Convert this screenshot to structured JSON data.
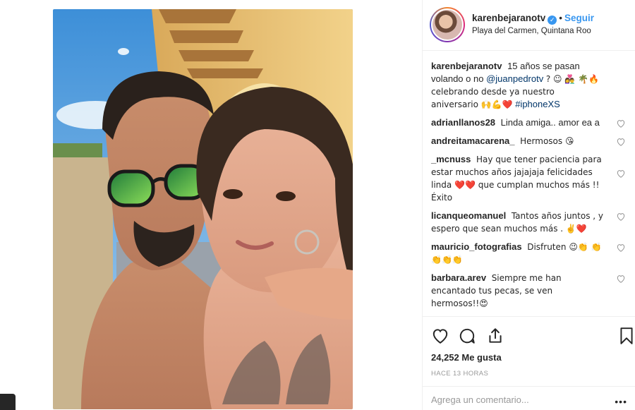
{
  "post": {
    "username": "karenbejaranotv",
    "follow_label": "Seguir",
    "dot": "•",
    "location": "Playa del Carmen, Quintana Roo",
    "caption": {
      "username": "karenbejaranotv",
      "text_1": "15 años se pasan volando o no",
      "mention": "@juanpedrotv",
      "text_2": "? ☺ 👩‍❤️‍👨 🌴🔥 celebrando desde ya nuestro aniversario 🙌💪❤️",
      "hashtag": "#iphoneXS"
    },
    "comments": [
      {
        "username": "adrianllanos28",
        "text": "Linda amiga.. amor ea a"
      },
      {
        "username": "andreitamacarena_",
        "text": "Hermosos 😘"
      },
      {
        "username": "_mcnuss",
        "text": "Hay que tener paciencia para estar muchos años jajajaja felicidades linda ❤️❤️ que cumplan muchos más !! Éxito"
      },
      {
        "username": "licanqueomanuel",
        "text": "Tantos años juntos , y espero que sean muchos más . ✌️❤️"
      },
      {
        "username": "mauricio_fotografias",
        "text": "Disfruten 😉👏 👏👏👏👏"
      },
      {
        "username": "barbara.arev",
        "text": "Siempre me han encantado tus pecas, se ven hermosos!!😍"
      }
    ],
    "likes": "24,252 Me gusta",
    "time": "HACE 13 HORAS",
    "comment_placeholder": "Agrega un comentario...",
    "more": "•••"
  },
  "colors": {
    "accent": "#3897f0",
    "text": "#262626",
    "muted": "#999999",
    "border": "#efefef"
  }
}
